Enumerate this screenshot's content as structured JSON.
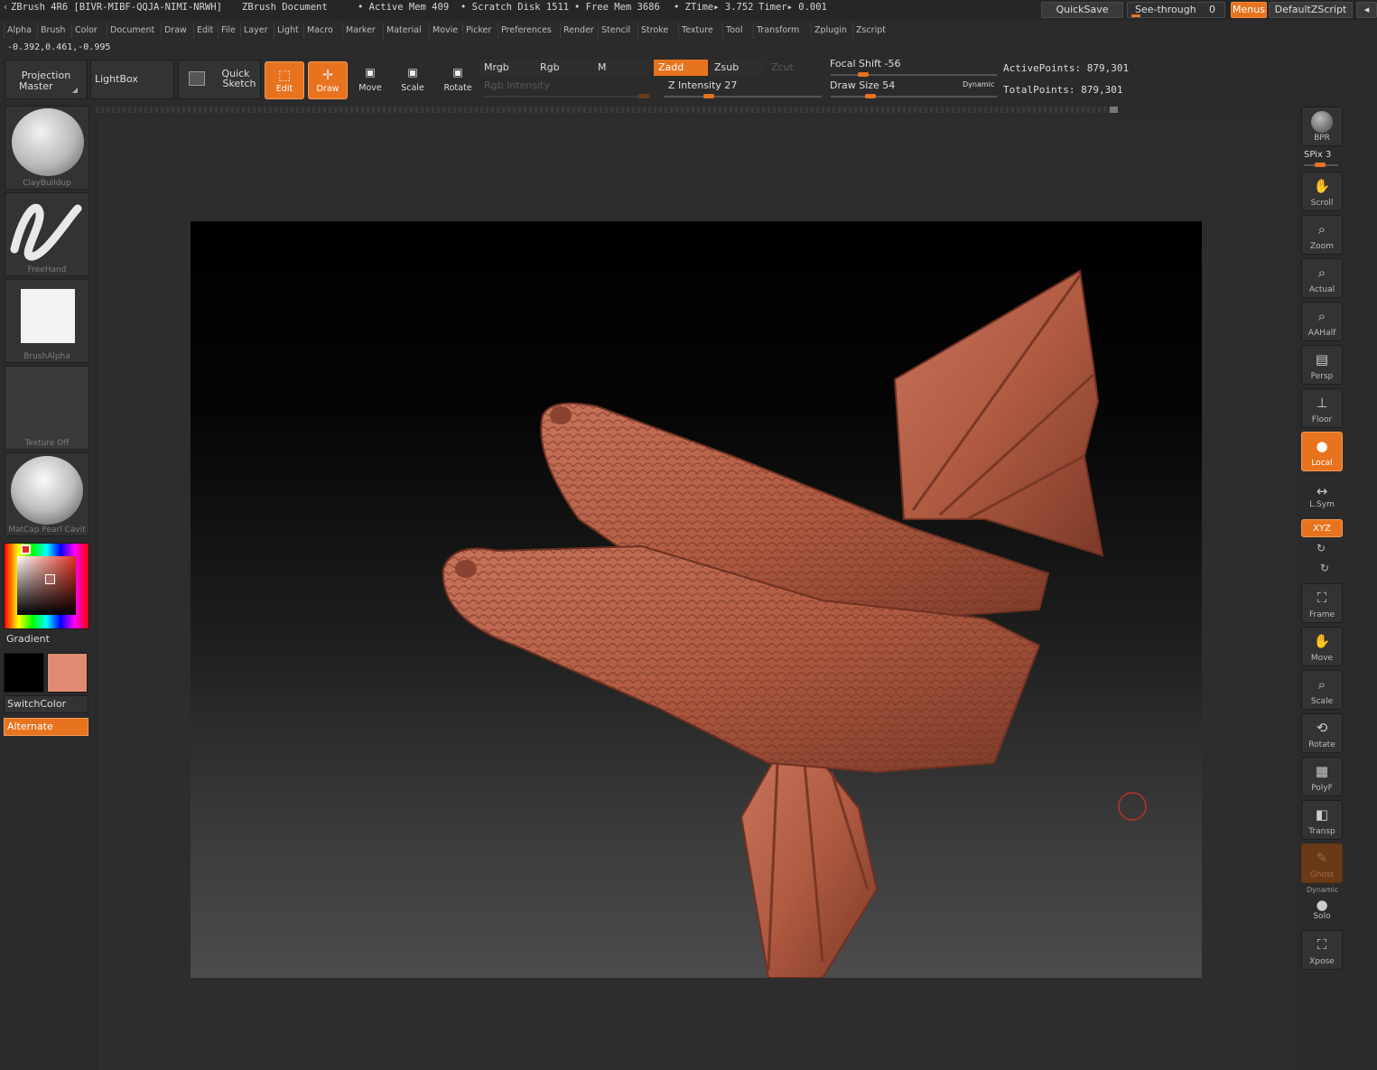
{
  "title_bar": {
    "app": "ZBrush 4R6 [BIVR-MIBF-QQJA-NIMI-NRWH]",
    "document": "ZBrush Document",
    "active_mem": "• Active Mem 409",
    "scratch_disk": "• Scratch Disk 1511",
    "free_mem": "• Free Mem 3686",
    "ztime": "• ZTime▸ 3.752",
    "timer": "Timer▸ 0.001",
    "quicksave": "QuickSave",
    "see_through": "See-through",
    "see_through_value": "0",
    "menus": "Menus",
    "default_zscript": "DefaultZScript"
  },
  "menu_items": [
    "Alpha",
    "Brush",
    "Color",
    "Document",
    "Draw",
    "Edit",
    "File",
    "Layer",
    "Light",
    "Macro",
    "Marker",
    "Material",
    "Movie",
    "Picker",
    "Preferences",
    "Render",
    "Stencil",
    "Stroke",
    "Texture",
    "Tool",
    "Transform",
    "Zplugin",
    "Zscript"
  ],
  "coords": "-0.392,0.461,-0.995",
  "shelf": {
    "projection_master_1": "Projection",
    "projection_master_2": "Master",
    "lightbox": "LightBox",
    "quick_sketch_1": "Quick",
    "quick_sketch_2": "Sketch",
    "edit": "Edit",
    "draw": "Draw",
    "move": "Move",
    "scale": "Scale",
    "rotate": "Rotate"
  },
  "paint_modes": {
    "mrgb": "Mrgb",
    "rgb": "Rgb",
    "m": "M",
    "zadd": "Zadd",
    "zsub": "Zsub",
    "zcut": "Zcut",
    "rgb_intensity": "Rgb  Intensity",
    "z_intensity": "Z Intensity 27",
    "focal_shift": "Focal Shift -56",
    "draw_size": "Draw Size 54",
    "dynamic": "Dynamic"
  },
  "slider_levels": {
    "z_intensity_fraction": 0.27,
    "focal_shift": -56,
    "draw_size": 54
  },
  "stats": {
    "active_points": "ActivePoints: 879,301",
    "total_points": "TotalPoints: 879,301"
  },
  "left_panel": {
    "brush": "ClayBuildup",
    "stroke": "FreeHand",
    "alpha": "BrushAlpha",
    "texture": "Texture  Off",
    "material": "MatCap  Pearl  Cavit",
    "gradient": "Gradient",
    "switch_color": "SwitchColor",
    "alternate": "Alternate"
  },
  "colors": {
    "accent": "#e8731f",
    "primary_color": "#000000",
    "secondary_color": "#e08a74",
    "model": "#b45c44"
  },
  "right_panel": {
    "bpr": "BPR",
    "spix": "SPix 3",
    "scroll": "Scroll",
    "zoom": "Zoom",
    "actual": "Actual",
    "aahalf": "AAHalf",
    "persp": "Persp",
    "floor": "Floor",
    "local": "Local",
    "lsym": "L.Sym",
    "xyz": "XYZ",
    "frame": "Frame",
    "move": "Move",
    "scale": "Scale",
    "rotate": "Rotate",
    "polyf": "PolyF",
    "transp": "Transp",
    "ghost": "Ghost",
    "dynamic": "Dynamic",
    "solo": "Solo",
    "xpose": "Xpose"
  }
}
